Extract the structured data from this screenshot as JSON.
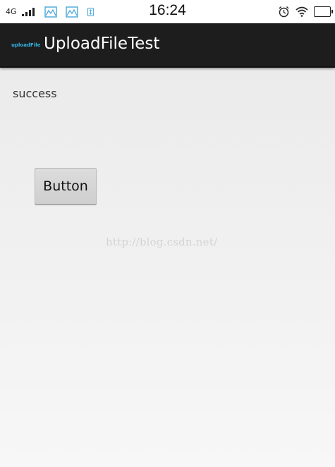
{
  "status_bar": {
    "network": "4G",
    "time": "16:24",
    "battery_level": "",
    "icons": [
      "signal-icon",
      "image-icon",
      "image-icon",
      "usb-icon",
      "alarm-icon",
      "wifi-icon",
      "battery-icon"
    ]
  },
  "action_bar": {
    "app_icon_label": "uploadFile",
    "title": "UploadFileTest"
  },
  "content": {
    "result_text": "success",
    "button_label": "Button",
    "watermark": "http://blog.csdn.net/"
  },
  "colors": {
    "action_bar_bg": "#1d1d1d",
    "icon_accent": "#33b5e5",
    "background": "#efefef"
  }
}
